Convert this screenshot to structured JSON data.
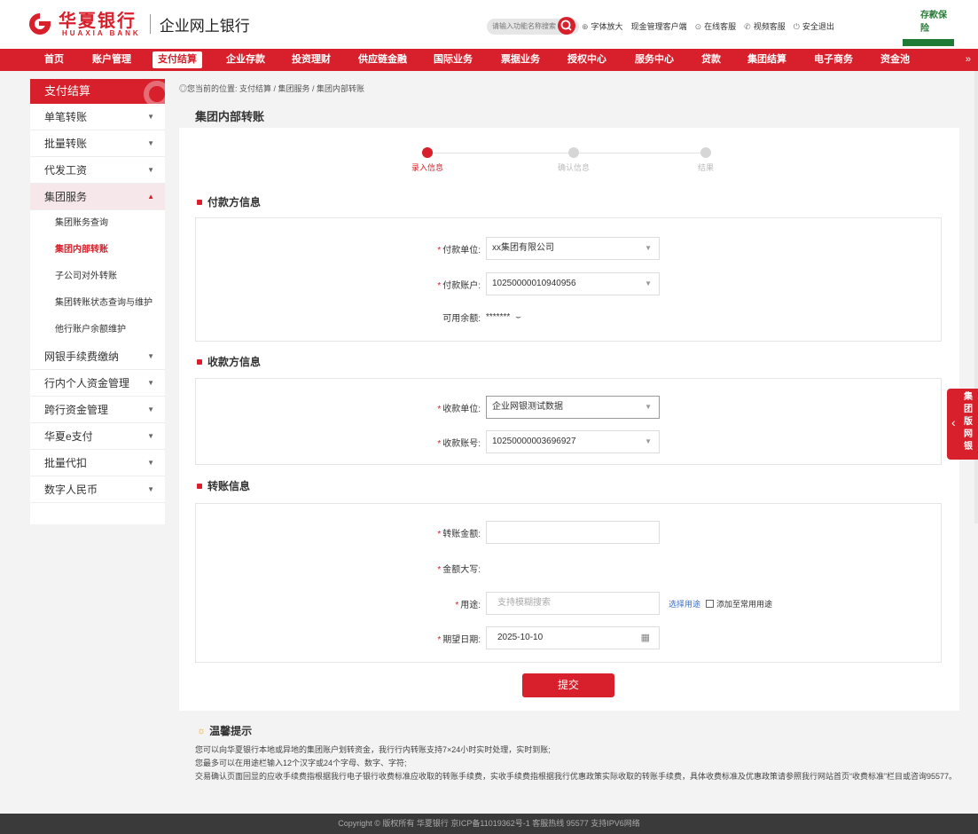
{
  "header": {
    "brand_cn": "华夏银行",
    "brand_en": "HUAXIA BANK",
    "brand_sub": "企业网上银行",
    "search_placeholder": "请输入功能名称搜索",
    "links": [
      "字体放大",
      "现金管理客户端",
      "在线客服",
      "视频客服",
      "安全退出"
    ],
    "insurance_label": "存款保险"
  },
  "nav": {
    "items": [
      "首页",
      "账户管理",
      "支付结算",
      "企业存款",
      "投资理财",
      "供应链金融",
      "国际业务",
      "票据业务",
      "授权中心",
      "服务中心",
      "贷款",
      "集团结算",
      "电子商务",
      "资金池"
    ],
    "active": "支付结算",
    "more": "»"
  },
  "sidebar": {
    "title": "支付结算",
    "items": [
      {
        "label": "单笔转账"
      },
      {
        "label": "批量转账"
      },
      {
        "label": "代发工资"
      },
      {
        "label": "集团服务"
      },
      {
        "label": "网银手续费缴纳"
      },
      {
        "label": "行内个人资金管理"
      },
      {
        "label": "跨行资金管理"
      },
      {
        "label": "华夏e支付"
      },
      {
        "label": "批量代扣"
      },
      {
        "label": "数字人民币"
      }
    ],
    "sub_items": [
      "集团账务查询",
      "集团内部转账",
      "子公司对外转账",
      "集团转账状态查询与维护",
      "他行账户余额维护"
    ]
  },
  "breadcrumb": "您当前的位置: 支付结算 / 集团服务 / 集团内部转账",
  "page_title": "集团内部转账",
  "steps": [
    "录入信息",
    "确认信息",
    "结果"
  ],
  "payer": {
    "section": "付款方信息",
    "unit_label": "付款单位:",
    "unit_value": "xx集团有限公司",
    "account_label": "付款账户:",
    "account_value": "10250000010940956",
    "balance_label": "可用余额:",
    "balance_value": "*******"
  },
  "payee": {
    "section": "收款方信息",
    "unit_label": "收款单位:",
    "unit_value": "企业网银测试数据",
    "account_label": "收款账号:",
    "account_value": "10250000003696927"
  },
  "transfer": {
    "section": "转账信息",
    "amount_label": "转账金额:",
    "amount_value": "",
    "upper_label": "金额大写:",
    "purpose_label": "用途:",
    "purpose_placeholder": "支持模糊搜索",
    "select_purpose": "选择用途",
    "add_common": "添加至常用用途",
    "date_label": "期望日期:",
    "date_value": "2025-10-10"
  },
  "submit_label": "提交",
  "tips": {
    "title": "温馨提示",
    "lines": [
      "您可以向华夏银行本地或异地的集团账户划转资金，我行行内转账支持7×24小时实时处理，实时到账;",
      "您最多可以在用途栏输入12个汉字或24个字母、数字、字符;",
      "交易确认页面回显的应收手续费指根据我行电子银行收费标准应收取的转账手续费，实收手续费指根据我行优惠政策实际收取的转账手续费，具体收费标准及优惠政策请参照我行网站首页“收费标准”栏目或咨询95577。"
    ]
  },
  "footer": "Copyright © 版权所有 华夏银行 京ICP备11019362号-1 客服热线 95577 支持IPV6网络",
  "floating_tab": "集团版网银",
  "colors": {
    "brand": "#d7202b",
    "footer": "#3a3a3a"
  }
}
